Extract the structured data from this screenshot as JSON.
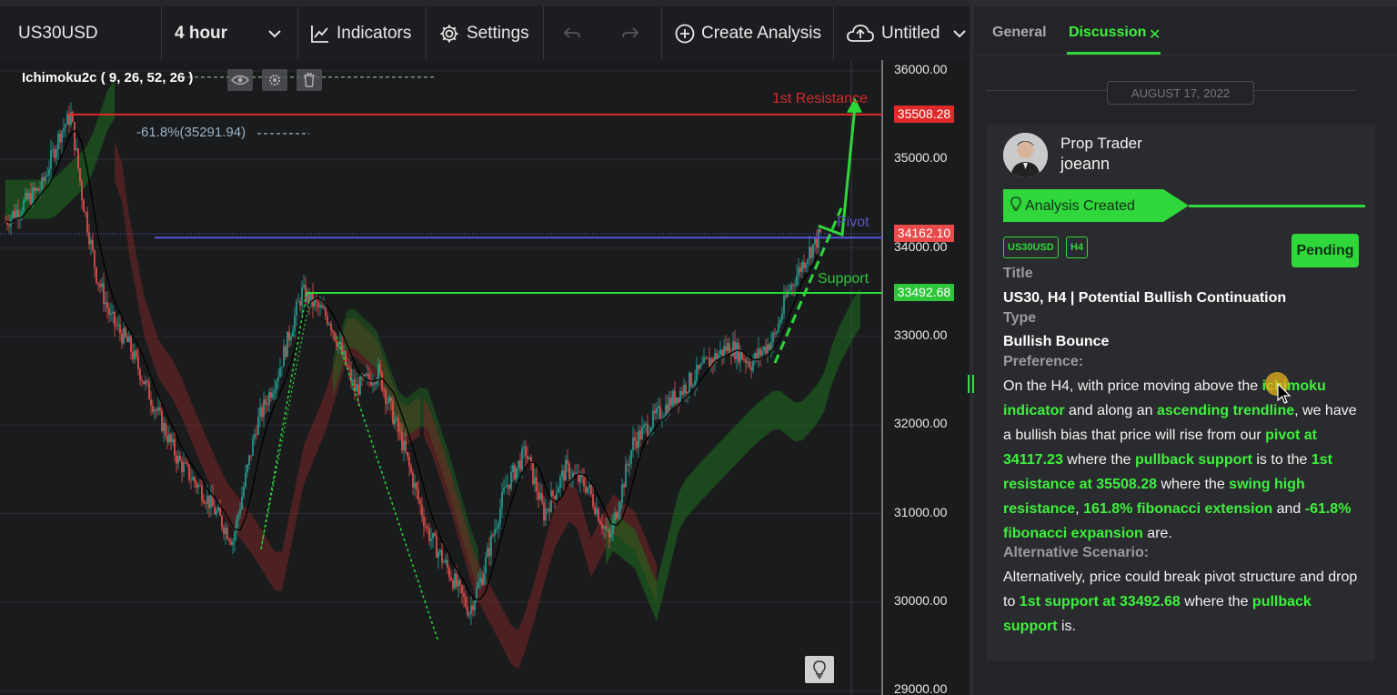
{
  "toolbar": {
    "symbol": "US30USD",
    "timeframe": "4 hour",
    "indicators": "Indicators",
    "settings": "Settings",
    "create_analysis": "Create Analysis",
    "untitled": "Untitled"
  },
  "chart": {
    "indicator_label": "Ichimoku2c ( 9, 26, 52, 26 )",
    "fib_label": "-61.8%(35291.94)",
    "resistance_label": "1st Resistance",
    "pivot_label": "Pivot",
    "support_label": "Support",
    "price_ticks": [
      "36000.00",
      "35000.00",
      "34000.00",
      "33000.00",
      "32000.00",
      "31000.00",
      "30000.00",
      "29000.00"
    ],
    "tag_resistance": "35508.28",
    "tag_pivot": "34162.10",
    "tag_support": "33492.68",
    "colors": {
      "resistance": "#e02a2a",
      "pivot": "#5555dd",
      "support": "#2fd73a",
      "up": "#26a69a",
      "down": "#ef5350"
    }
  },
  "panel": {
    "tab_general": "General",
    "tab_discussion": "Discussion",
    "date": "AUGUST 17, 2022",
    "author_role": "Prop Trader",
    "author_name": "joeann",
    "status_banner": "Analysis Created",
    "tag_symbol": "US30USD",
    "tag_tf": "H4",
    "pending": "Pending",
    "title_label": "Title",
    "title_value": "US30, H4 | Potential Bullish Continuation",
    "type_label": "Type",
    "type_value": "Bullish Bounce",
    "preference_label": "Preference:",
    "alt_label": "Alternative Scenario:",
    "pref": {
      "t1": "On the H4, with price moving above the ",
      "h1": "ichimoku indicator",
      "t2": " and along an ",
      "h2": "ascending trendline",
      "t3": ", we have a bullish bias that price will rise from our ",
      "h3": "pivot at 34117.23",
      "t4": " where the ",
      "h4": "pullback support",
      "t5": " is to the ",
      "h5": "1st resistance at 35508.28",
      "t6": " where the ",
      "h6": "swing high resistance",
      "t7": ", ",
      "h7": "161.8% fibonacci extension",
      "t8": " and ",
      "h8": "-61.8% fibonacci expansion",
      "t9": " are."
    },
    "alt": {
      "t1": "Alternatively, price could break pivot structure and drop to ",
      "h1": "1st support at 33492.68",
      "t2": " where the ",
      "h2": "pullback support",
      "t3": " is."
    }
  }
}
